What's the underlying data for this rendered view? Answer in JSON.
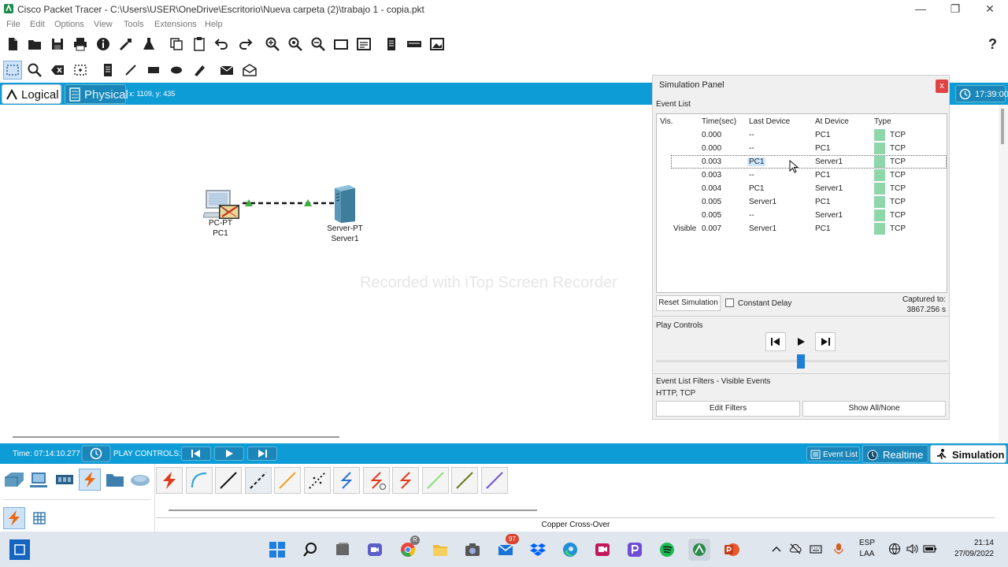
{
  "window": {
    "title": "Cisco Packet Tracer - C:\\Users\\USER\\OneDrive\\Escritorio\\Nueva carpeta (2)\\trabajo 1 - copia.pkt",
    "minimize": "—",
    "maximize": "❐",
    "close": "✕"
  },
  "menu": [
    "File",
    "Edit",
    "Options",
    "View",
    "Tools",
    "Extensions",
    "Help"
  ],
  "help_glyph": "?",
  "modebar": {
    "logical": "Logical",
    "physical": "Physical",
    "coords": "x: 1109, y: 435",
    "clock": "17:39:00"
  },
  "topology": {
    "devices": [
      {
        "type": "PC-PT",
        "name": "PC1"
      },
      {
        "type": "Server-PT",
        "name": "Server1"
      }
    ],
    "link": "Copper Cross-Over"
  },
  "watermark": "Recorded with iTop Screen Recorder",
  "simulation_panel": {
    "title": "Simulation Panel",
    "close": "x",
    "event_list_label": "Event List",
    "columns": [
      "Vis.",
      "Time(sec)",
      "Last Device",
      "At Device",
      "Type"
    ],
    "events": [
      {
        "vis": "",
        "time": "0.000",
        "last": "--",
        "at": "PC1",
        "type": "TCP"
      },
      {
        "vis": "",
        "time": "0.000",
        "last": "--",
        "at": "PC1",
        "type": "TCP"
      },
      {
        "vis": "",
        "time": "0.003",
        "last": "PC1",
        "at": "Server1",
        "type": "TCP"
      },
      {
        "vis": "",
        "time": "0.003",
        "last": "--",
        "at": "PC1",
        "type": "TCP"
      },
      {
        "vis": "",
        "time": "0.004",
        "last": "PC1",
        "at": "Server1",
        "type": "TCP"
      },
      {
        "vis": "",
        "time": "0.005",
        "last": "Server1",
        "at": "PC1",
        "type": "TCP"
      },
      {
        "vis": "",
        "time": "0.005",
        "last": "--",
        "at": "Server1",
        "type": "TCP"
      },
      {
        "vis": "Visible",
        "time": "0.007",
        "last": "Server1",
        "at": "PC1",
        "type": "TCP"
      }
    ],
    "event_type_color": "#8fd6ab",
    "reset_simulation": "Reset Simulation",
    "constant_delay": "Constant Delay",
    "captured_to_label": "Captured to:",
    "captured_to_value": "3867.256 s",
    "play_controls_label": "Play Controls",
    "filters_label": "Event List Filters - Visible Events",
    "filters_value": "HTTP, TCP",
    "edit_filters": "Edit Filters",
    "show_all": "Show All/None"
  },
  "playbar": {
    "time": "Time: 07:14:10.277",
    "play_controls": "PLAY CONTROLS:",
    "event_list": "Event List",
    "realtime": "Realtime",
    "simulation": "Simulation"
  },
  "device_panel": {
    "selected_connection": "Copper Cross-Over"
  },
  "taskbar": {
    "outlook_badge": "97",
    "chrome_badge": "R",
    "lang_1": "ESP",
    "lang_2": "LAA",
    "time": "21:14",
    "date": "27/09/2022"
  },
  "colors": {
    "accent_blue": "#0e9cd6",
    "selection_blue": "#1e7fd8",
    "close_red": "#e04343"
  }
}
